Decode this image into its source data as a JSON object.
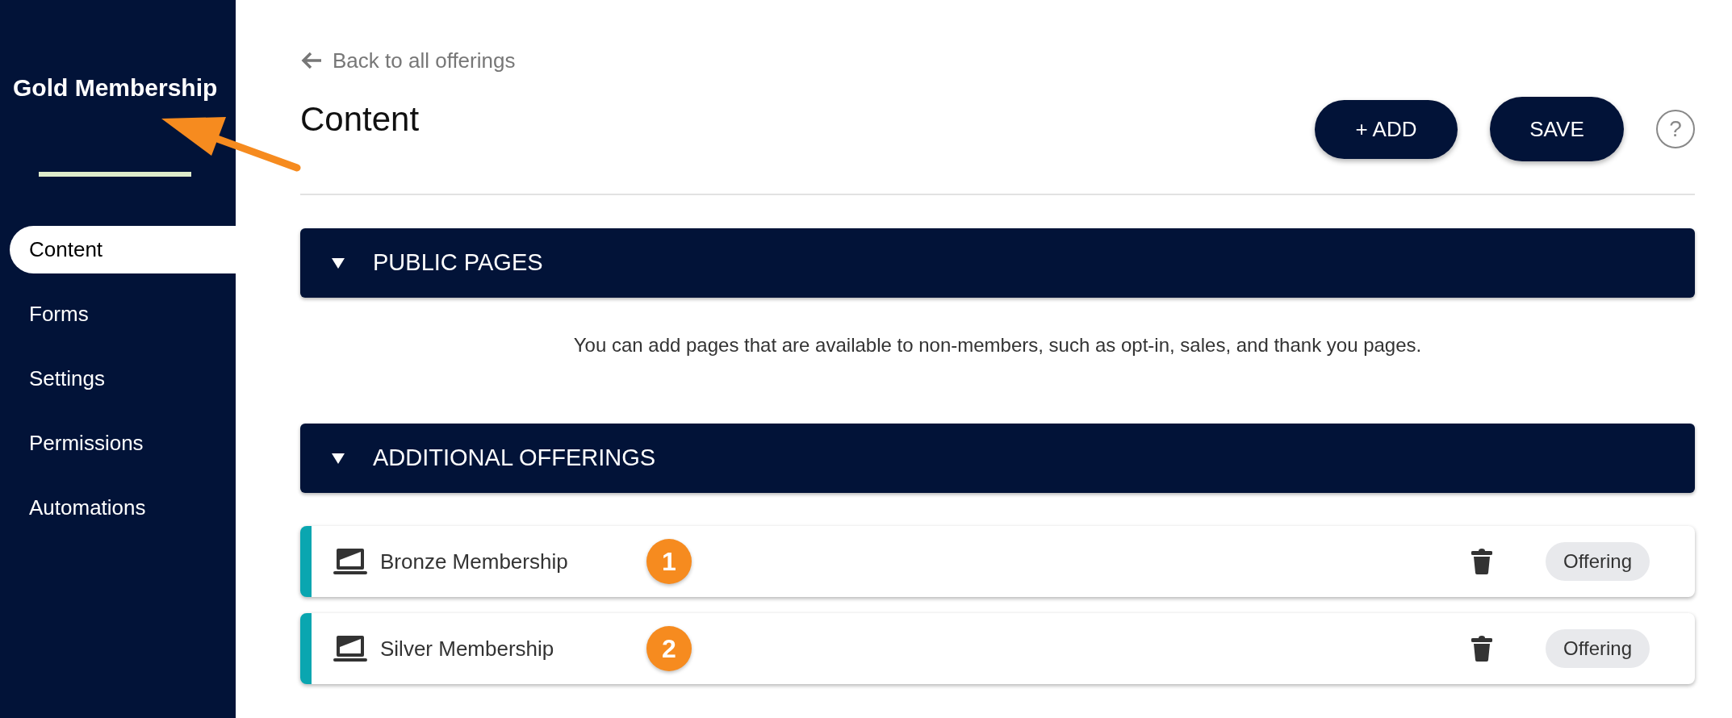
{
  "sidebar": {
    "title": "Gold Membership",
    "items": [
      {
        "label": "Content",
        "selected": true
      },
      {
        "label": "Forms",
        "selected": false
      },
      {
        "label": "Settings",
        "selected": false
      },
      {
        "label": "Permissions",
        "selected": false
      },
      {
        "label": "Automations",
        "selected": false
      }
    ]
  },
  "back_link": "Back to all offerings",
  "heading": "Content",
  "buttons": [
    "+ ADD",
    "SAVE"
  ],
  "help": "?",
  "sections": [
    {
      "title": "PUBLIC PAGES",
      "expanded": true,
      "description": "You can add pages that are available to non-members, such as opt-in, sales, and thank you pages."
    },
    {
      "title": "ADDITIONAL OFFERINGS",
      "expanded": true,
      "items": [
        {
          "name": "Bronze Membership",
          "marker": "1",
          "tag": "Offering"
        },
        {
          "name": "Silver Membership",
          "marker": "2",
          "tag": "Offering"
        }
      ]
    }
  ]
}
